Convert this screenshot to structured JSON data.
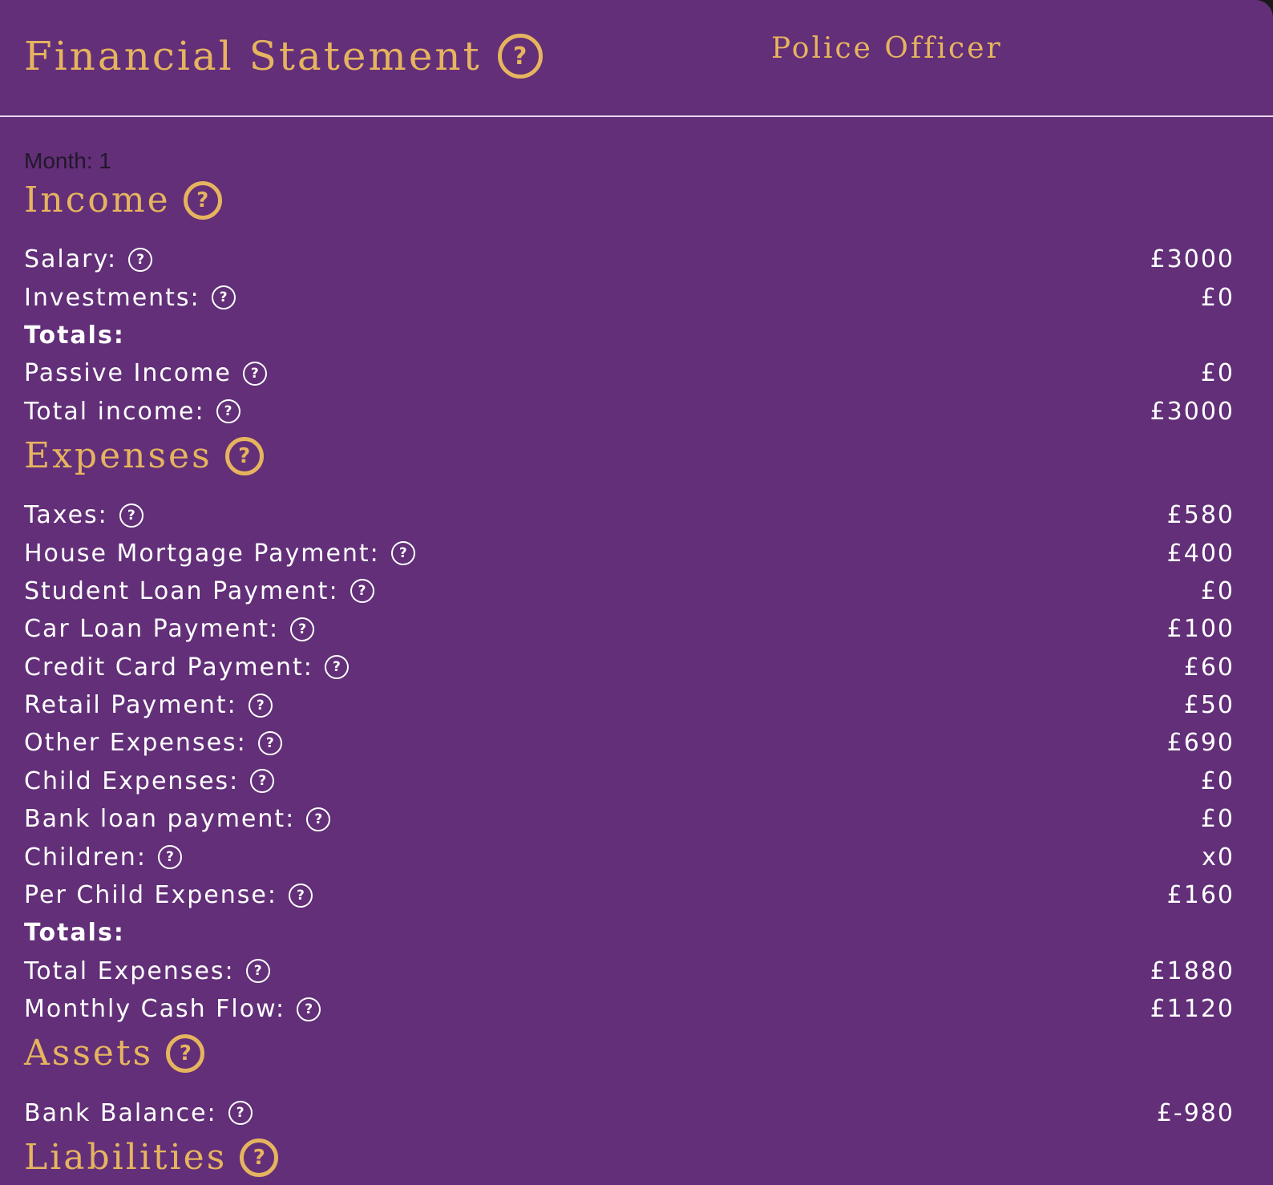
{
  "header": {
    "title": "Financial Statement",
    "help_icon": "?",
    "profession": "Police Officer"
  },
  "month_label": "Month: 1",
  "help_glyph": "?",
  "income": {
    "title": "Income",
    "rows": [
      {
        "label": "Salary:",
        "value": "£3000"
      },
      {
        "label": "Investments:",
        "value": "£0"
      }
    ],
    "totals_label": "Totals:",
    "totals": [
      {
        "label": "Passive Income",
        "value": "£0"
      },
      {
        "label": "Total income:",
        "value": "£3000"
      }
    ]
  },
  "expenses": {
    "title": "Expenses",
    "rows": [
      {
        "label": "Taxes:",
        "value": "£580"
      },
      {
        "label": "House Mortgage Payment:",
        "value": "£400"
      },
      {
        "label": "Student Loan Payment:",
        "value": "£0"
      },
      {
        "label": "Car Loan Payment:",
        "value": "£100"
      },
      {
        "label": "Credit Card Payment:",
        "value": "£60"
      },
      {
        "label": "Retail Payment:",
        "value": "£50"
      },
      {
        "label": "Other Expenses:",
        "value": "£690"
      },
      {
        "label": "Child Expenses:",
        "value": "£0"
      },
      {
        "label": "Bank loan payment:",
        "value": "£0"
      },
      {
        "label": "Children:",
        "value": "x0"
      },
      {
        "label": "Per Child Expense:",
        "value": "£160"
      }
    ],
    "totals_label": "Totals:",
    "totals": [
      {
        "label": "Total Expenses:",
        "value": "£1880"
      },
      {
        "label": "Monthly Cash Flow:",
        "value": "£1120"
      }
    ]
  },
  "assets": {
    "title": "Assets",
    "rows": [
      {
        "label": "Bank Balance:",
        "value": "£-980"
      }
    ]
  },
  "liabilities": {
    "title": "Liabilities"
  },
  "colors": {
    "background": "#622f78",
    "accent_gold": "#e6b45f",
    "text": "#ffffff"
  },
  "icons": {
    "help": "question-circle-icon"
  }
}
